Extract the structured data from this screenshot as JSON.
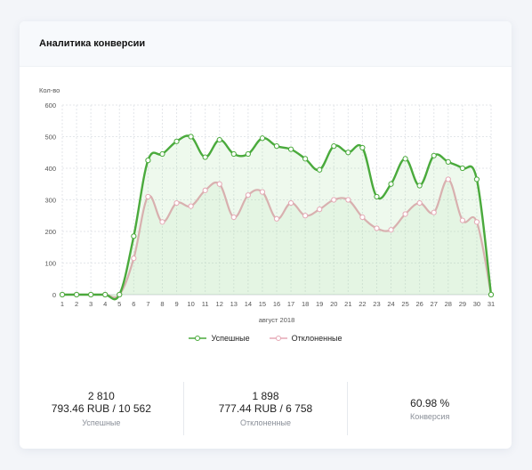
{
  "card": {
    "title": "Аналитика конверсии"
  },
  "chart_data": {
    "type": "line",
    "ylabel": "Кол-во",
    "xlabel": "август 2018",
    "ylim": [
      0,
      600
    ],
    "yticks": [
      0,
      100,
      200,
      300,
      400,
      500,
      600
    ],
    "x": [
      1,
      2,
      3,
      4,
      5,
      6,
      7,
      8,
      9,
      10,
      11,
      12,
      13,
      14,
      15,
      16,
      17,
      18,
      19,
      20,
      21,
      22,
      23,
      24,
      25,
      26,
      27,
      28,
      29,
      30,
      31
    ],
    "series": [
      {
        "name": "Успешные",
        "color": "#4aaa3c",
        "values": [
          0,
          0,
          0,
          0,
          0,
          185,
          425,
          445,
          485,
          500,
          435,
          490,
          445,
          445,
          495,
          470,
          460,
          430,
          395,
          470,
          450,
          465,
          310,
          350,
          430,
          345,
          440,
          420,
          400,
          365,
          0
        ]
      },
      {
        "name": "Отклоненные",
        "color": "#e5a9b5",
        "values": [
          0,
          0,
          0,
          0,
          0,
          115,
          310,
          230,
          290,
          280,
          330,
          350,
          245,
          315,
          325,
          240,
          290,
          250,
          270,
          300,
          300,
          245,
          210,
          205,
          255,
          290,
          260,
          365,
          235,
          230,
          0
        ]
      }
    ],
    "grid": true,
    "legend_position": "bottom-center"
  },
  "stats": [
    {
      "count": "2 810",
      "amount": "793.46 RUB / 10 562",
      "label": "Успешные"
    },
    {
      "count": "1 898",
      "amount": "777.44 RUB / 6 758",
      "label": "Отклоненные"
    },
    {
      "value": "60.98 %",
      "label": "Конверсия"
    }
  ]
}
